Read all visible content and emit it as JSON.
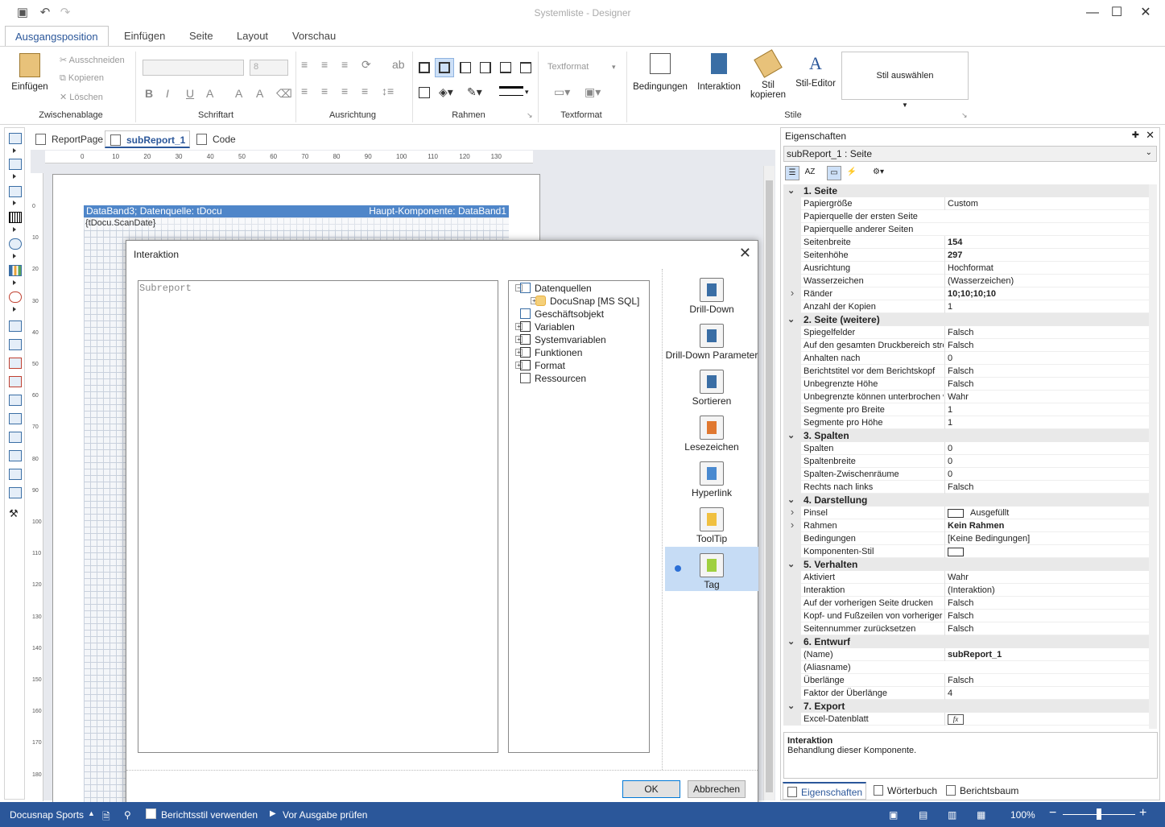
{
  "window": {
    "title": "Systemliste - Designer"
  },
  "quick_access": {
    "save": "save-icon",
    "undo": "undo-icon",
    "redo": "redo-icon"
  },
  "ribbon_tabs": [
    "Ausgangsposition",
    "Einfügen",
    "Seite",
    "Layout",
    "Vorschau"
  ],
  "clipboard": {
    "paste": "Einfügen",
    "cut": "Ausschneiden",
    "copy": "Kopieren",
    "delete": "Löschen",
    "label": "Zwischenablage"
  },
  "font": {
    "name_value": "",
    "size_value": "8",
    "label": "Schriftart"
  },
  "alignment": {
    "label": "Ausrichtung"
  },
  "borders": {
    "label": "Rahmen"
  },
  "textformat": {
    "value": "Textformat",
    "label": "Textformat"
  },
  "styles": {
    "conditions": "Bedingungen",
    "interaction": "Interaktion",
    "copy_style_1": "Stil",
    "copy_style_2": "kopieren",
    "style_editor": "Stil-Editor",
    "select_style": "Stil auswählen",
    "label": "Stile"
  },
  "doc_tabs": [
    "ReportPage",
    "subReport_1",
    "Code"
  ],
  "ruler": [
    "0",
    "10",
    "20",
    "30",
    "40",
    "50",
    "60",
    "70",
    "80",
    "90",
    "100",
    "110",
    "120",
    "130"
  ],
  "vruler": [
    "0",
    "10",
    "20",
    "30",
    "40",
    "50",
    "60",
    "70",
    "80",
    "90",
    "100",
    "110",
    "120",
    "130",
    "140",
    "150",
    "160",
    "170",
    "180"
  ],
  "band": {
    "left": "DataBand3; Datenquelle: tDocu",
    "right": "Haupt-Komponente: DataBand1",
    "field": "{tDocu.ScanDate}"
  },
  "dialog": {
    "title": "Interaktion",
    "editor_text": "Subreport",
    "tree": [
      {
        "label": "Datenquellen",
        "pm": "−"
      },
      {
        "label": "DocuSnap [MS SQL]",
        "pm": "+"
      },
      {
        "label": "Geschäftsobjekt",
        "pm": ""
      },
      {
        "label": "Variablen",
        "pm": "+"
      },
      {
        "label": "Systemvariablen",
        "pm": "+"
      },
      {
        "label": "Funktionen",
        "pm": "+"
      },
      {
        "label": "Format",
        "pm": "+"
      },
      {
        "label": "Ressourcen",
        "pm": ""
      }
    ],
    "actions": [
      "Drill-Down",
      "Drill-Down Parameter",
      "Sortieren",
      "Lesezeichen",
      "Hyperlink",
      "ToolTip",
      "Tag"
    ],
    "ok": "OK",
    "cancel": "Abbrechen"
  },
  "properties": {
    "header": "Eigenschaften",
    "selected": "subReport_1 : Seite",
    "rows": [
      {
        "type": "cat",
        "name": "1. Seite"
      },
      {
        "name": "Papiergröße",
        "value": "Custom"
      },
      {
        "name": "Papierquelle der ersten Seite",
        "value": ""
      },
      {
        "name": "Papierquelle anderer Seiten",
        "value": ""
      },
      {
        "name": "Seitenbreite",
        "value": "154",
        "bold": true
      },
      {
        "name": "Seitenhöhe",
        "value": "297",
        "bold": true
      },
      {
        "name": "Ausrichtung",
        "value": "Hochformat"
      },
      {
        "name": "Wasserzeichen",
        "value": "(Wasserzeichen)"
      },
      {
        "name": "Ränder",
        "value": "10;10;10;10",
        "bold": true,
        "expand": true
      },
      {
        "name": "Anzahl der Kopien",
        "value": "1"
      },
      {
        "type": "cat",
        "name": "2. Seite (weitere)"
      },
      {
        "name": "Spiegelfelder",
        "value": "Falsch"
      },
      {
        "name": "Auf den gesamten Druckbereich strecken",
        "value": "Falsch"
      },
      {
        "name": "Anhalten nach",
        "value": "0"
      },
      {
        "name": "Berichtstitel vor dem Berichtskopf",
        "value": "Falsch"
      },
      {
        "name": "Unbegrenzte Höhe",
        "value": "Falsch"
      },
      {
        "name": "Unbegrenzte können unterbrochen werden",
        "value": "Wahr"
      },
      {
        "name": "Segmente pro Breite",
        "value": "1"
      },
      {
        "name": "Segmente pro Höhe",
        "value": "1"
      },
      {
        "type": "cat",
        "name": "3. Spalten"
      },
      {
        "name": "Spalten",
        "value": "0"
      },
      {
        "name": "Spaltenbreite",
        "value": "0"
      },
      {
        "name": "Spalten-Zwischenräume",
        "value": "0"
      },
      {
        "name": "Rechts nach links",
        "value": "Falsch"
      },
      {
        "type": "cat",
        "name": "4. Darstellung"
      },
      {
        "name": "Pinsel",
        "value": "Ausgefüllt",
        "swatch": true,
        "expand": true
      },
      {
        "name": "Rahmen",
        "value": "Kein Rahmen",
        "bold": true,
        "expand": true
      },
      {
        "name": "Bedingungen",
        "value": "[Keine Bedingungen]"
      },
      {
        "name": "Komponenten-Stil",
        "value": "",
        "swatch": true
      },
      {
        "type": "cat",
        "name": "5. Verhalten"
      },
      {
        "name": "Aktiviert",
        "value": "Wahr"
      },
      {
        "name": "Interaktion",
        "value": "(Interaktion)"
      },
      {
        "name": "Auf der vorherigen Seite drucken",
        "value": "Falsch"
      },
      {
        "name": "Kopf- und Fußzeilen von vorheriger Seite",
        "value": "Falsch"
      },
      {
        "name": "Seitennummer zurücksetzen",
        "value": "Falsch"
      },
      {
        "type": "cat",
        "name": "6. Entwurf"
      },
      {
        "name": "(Name)",
        "value": "subReport_1",
        "bold": true
      },
      {
        "name": "(Aliasname)",
        "value": ""
      },
      {
        "name": "Überlänge",
        "value": "Falsch"
      },
      {
        "name": "Faktor der Überlänge",
        "value": "4"
      },
      {
        "type": "cat",
        "name": "7. Export"
      },
      {
        "name": "Excel-Datenblatt",
        "value": "fx",
        "fx": true
      }
    ],
    "description_title": "Interaktion",
    "description_text": "Behandlung dieser Komponente.",
    "tabs": [
      "Eigenschaften",
      "Wörterbuch",
      "Berichtsbaum"
    ]
  },
  "status": {
    "app": "Docusnap Sports",
    "report_style": "Berichtsstil verwenden",
    "check_output": "Vor Ausgabe prüfen",
    "zoom": "100%"
  }
}
